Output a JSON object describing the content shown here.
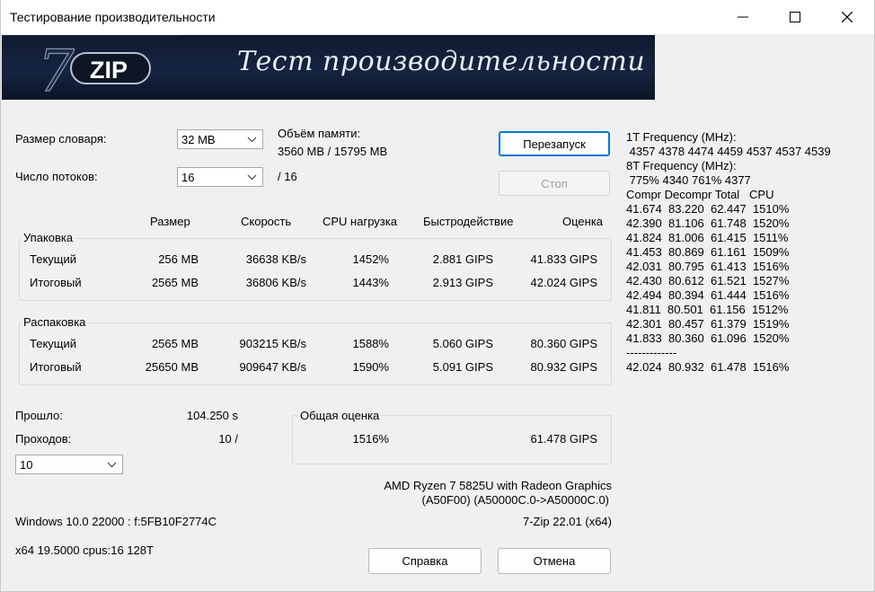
{
  "window": {
    "title": "Тестирование производительности",
    "controls": [
      "minimize-icon",
      "maximize-icon",
      "close-icon"
    ]
  },
  "banner": {
    "logo_text": "ZIP",
    "logo_numeral": "7",
    "caption": "Тест производительности"
  },
  "settings": {
    "dict_label": "Размер словаря:",
    "dict_value": "32 MB",
    "threads_label": "Число потоков:",
    "threads_value": "16",
    "threads_max": "/ 16",
    "memory_label": "Объём памяти:",
    "memory_value": "3560 MB / 15795 MB"
  },
  "buttons": {
    "restart": "Перезапуск",
    "stop": "Стоп",
    "help": "Справка",
    "cancel": "Отмена"
  },
  "table": {
    "headers": [
      "Размер",
      "Скорость",
      "CPU нагрузка",
      "Быстродействие",
      "Оценка"
    ],
    "compress": {
      "label": "Упаковка",
      "rows": [
        {
          "name": "Текущий",
          "size": "256 MB",
          "speed": "36638 KB/s",
          "cpu": "1452%",
          "perf": "2.881 GIPS",
          "rating": "41.833 GIPS"
        },
        {
          "name": "Итоговый",
          "size": "2565 MB",
          "speed": "36806 KB/s",
          "cpu": "1443%",
          "perf": "2.913 GIPS",
          "rating": "42.024 GIPS"
        }
      ]
    },
    "decompress": {
      "label": "Распаковка",
      "rows": [
        {
          "name": "Текущий",
          "size": "2565 MB",
          "speed": "903215 KB/s",
          "cpu": "1588%",
          "perf": "5.060 GIPS",
          "rating": "80.360 GIPS"
        },
        {
          "name": "Итоговый",
          "size": "25650 MB",
          "speed": "909647 KB/s",
          "cpu": "1590%",
          "perf": "5.091 GIPS",
          "rating": "80.932 GIPS"
        }
      ]
    }
  },
  "progress": {
    "elapsed_label": "Прошло:",
    "elapsed_value": "104.250 s",
    "passes_label": "Проходов:",
    "passes_value": "10 /",
    "passes_combo": "10"
  },
  "total": {
    "label": "Общая оценка",
    "cpu": "1516%",
    "rating": "61.478 GIPS"
  },
  "system": {
    "cpu_name": "AMD Ryzen 7 5825U with Radeon Graphics",
    "cpu_id": "(A50F00) (A50000C.0->A50000C.0)",
    "os": "Windows 10.0 22000 :  f:5FB10F2774C",
    "version": "7-Zip 22.01 (x64)",
    "arch": "x64 19.5000 cpus:16 128T"
  },
  "right_panel": [
    "1T Frequency (MHz):",
    " 4357 4378 4474 4459 4537 4537 4539",
    "8T Frequency (MHz):",
    " 775% 4340 761% 4377",
    "Compr Decompr Total   CPU",
    "41.674  83.220  62.447  1510%",
    "42.390  81.106  61.748  1520%",
    "41.824  81.006  61.415  1511%",
    "41.453  80.869  61.161  1509%",
    "42.031  80.795  61.413  1516%",
    "42.430  80.612  61.521  1527%",
    "42.494  80.394  61.444  1516%",
    "41.811  80.501  61.156  1512%",
    "42.301  80.457  61.379  1519%",
    "41.833  80.360  61.096  1520%",
    "-------------",
    "42.024  80.932  61.478  1516%"
  ]
}
